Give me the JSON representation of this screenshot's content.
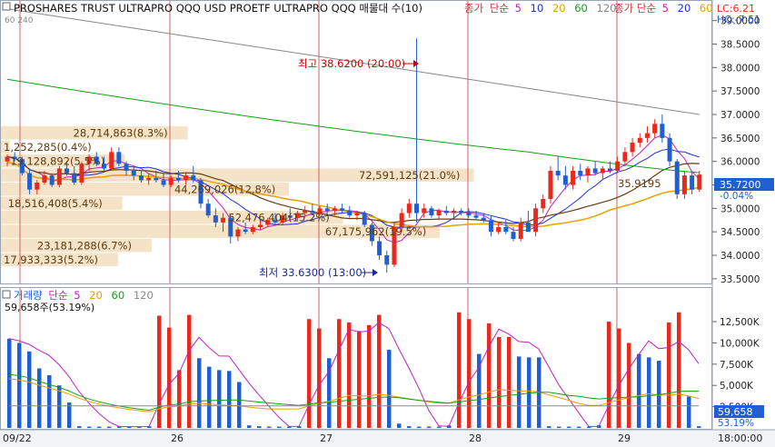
{
  "header": {
    "title": "PROSHARES TRUST ULTRAPRO QQQ USD  PROETF ULTRAPRO QQQ 매물대 수(10)",
    "price_label": "종가",
    "ma_label": "단순",
    "ma_periods": [
      "5",
      "10",
      "20",
      "60",
      "120"
    ],
    "ma_label_b": "종가 단순",
    "ma_periods_b": [
      "5",
      "20",
      "60"
    ],
    "lc": "LC:6.21",
    "hc": "HC:-7.51",
    "corner_label": "60 240"
  },
  "price_panel": {
    "y_ticks": [
      "39.0000",
      "38.5000",
      "38.0000",
      "37.5000",
      "37.0000",
      "36.5000",
      "36.0000",
      "35.5000",
      "35.0000",
      "34.5000",
      "34.0000",
      "33.5000"
    ],
    "current_price": "35.7200",
    "current_change": "-0.04%",
    "high_note": "최고 38.6200 (20:00)",
    "low_note": "최저 33.6300 (13:00)",
    "volume_profile": [
      {
        "label": "28,714,863(8.3%)",
        "price_top": 36.75,
        "price_bottom": 36.45,
        "value": 8.3
      },
      {
        "label": "1,252,285(0.4%)",
        "price_top": 36.45,
        "price_bottom": 36.15,
        "value": 0.4
      },
      {
        "label": "19,128,892(5.5%)",
        "price_top": 36.15,
        "price_bottom": 35.85,
        "value": 5.5
      },
      {
        "label": "72,591,125(21.0%)",
        "price_top": 35.85,
        "price_bottom": 35.55,
        "value": 21.0
      },
      {
        "label": "44,269,026(12.8%)",
        "price_top": 35.55,
        "price_bottom": 35.25,
        "value": 12.8
      },
      {
        "label": "18,516,408(5.4%)",
        "price_top": 35.25,
        "price_bottom": 34.95,
        "value": 5.4
      },
      {
        "label": "52,476,404(15.2%)",
        "price_top": 34.95,
        "price_bottom": 34.65,
        "value": 15.2
      },
      {
        "label": "67,175,962(19.5%)",
        "price_top": 34.65,
        "price_bottom": 34.35,
        "value": 19.5
      },
      {
        "label": "23,181,288(6.7%)",
        "price_top": 34.35,
        "price_bottom": 34.05,
        "value": 6.7
      },
      {
        "label": "17,933,333(5.2%)",
        "price_top": 34.05,
        "price_bottom": 33.75,
        "value": 5.2
      }
    ],
    "overlay_label": "35.9195"
  },
  "volume_panel": {
    "title": "거래량",
    "ma_label": "단순",
    "ma_periods": [
      "5",
      "20",
      "60",
      "120"
    ],
    "current_info": "59,658주(53.19%)",
    "y_ticks": [
      "12,500K",
      "10,000K",
      "7,500K",
      "5,000K",
      "2,500K"
    ],
    "current_value": "59,658",
    "current_pct": "53.19%"
  },
  "x_axis": {
    "labels": [
      "09/22",
      "26",
      "27",
      "28",
      "29",
      "18:00:00"
    ]
  },
  "colors": {
    "up": "#e8291c",
    "down": "#1f5fd1",
    "ma5": "#c21fc0",
    "ma10": "#1d2fd8",
    "ma20": "#6b3a12",
    "ma60": "#16a016",
    "ma120": "#888888",
    "ma_orange": "#e8a000",
    "profile": "#f5e3c8",
    "session": "#d06060"
  },
  "chart_data": {
    "type": "candlestick",
    "price_range": [
      33.4,
      39.4
    ],
    "volume_range": [
      0,
      14000
    ],
    "candles": [
      [
        36.0,
        36.15,
        35.9,
        36.1
      ],
      [
        36.1,
        36.2,
        36.0,
        36.05
      ],
      [
        36.05,
        36.1,
        35.7,
        35.75
      ],
      [
        35.75,
        35.85,
        35.3,
        35.4
      ],
      [
        35.4,
        35.6,
        35.3,
        35.55
      ],
      [
        35.55,
        35.8,
        35.5,
        35.7
      ],
      [
        35.7,
        35.75,
        35.45,
        35.5
      ],
      [
        35.5,
        35.9,
        35.45,
        35.85
      ],
      [
        35.85,
        36.0,
        35.7,
        35.75
      ],
      [
        35.75,
        35.9,
        35.5,
        35.55
      ],
      [
        35.55,
        36.0,
        35.5,
        35.95
      ],
      [
        35.95,
        36.15,
        35.8,
        36.1
      ],
      [
        36.1,
        36.2,
        35.9,
        35.95
      ],
      [
        35.95,
        36.1,
        35.8,
        35.85
      ],
      [
        35.85,
        36.3,
        35.8,
        36.2
      ],
      [
        36.2,
        36.3,
        35.9,
        35.95
      ],
      [
        35.95,
        36.0,
        35.7,
        35.8
      ],
      [
        35.8,
        35.9,
        35.6,
        35.7
      ],
      [
        35.7,
        35.8,
        35.55,
        35.6
      ],
      [
        35.6,
        35.75,
        35.5,
        35.65
      ],
      [
        35.65,
        35.8,
        35.55,
        35.6
      ],
      [
        35.6,
        35.75,
        35.45,
        35.5
      ],
      [
        35.5,
        35.7,
        35.45,
        35.65
      ],
      [
        35.65,
        35.8,
        35.55,
        35.6
      ],
      [
        35.6,
        35.75,
        35.5,
        35.7
      ],
      [
        35.7,
        35.9,
        35.55,
        35.6
      ],
      [
        35.6,
        35.65,
        35.0,
        35.1
      ],
      [
        35.1,
        35.2,
        34.8,
        34.85
      ],
      [
        34.85,
        35.0,
        34.6,
        34.7
      ],
      [
        34.7,
        34.9,
        34.5,
        34.8
      ],
      [
        34.8,
        34.85,
        34.25,
        34.4
      ],
      [
        34.4,
        34.6,
        34.3,
        34.55
      ],
      [
        34.55,
        34.7,
        34.45,
        34.5
      ],
      [
        34.5,
        34.65,
        34.45,
        34.6
      ],
      [
        34.6,
        34.75,
        34.55,
        34.65
      ],
      [
        34.65,
        34.8,
        34.6,
        34.75
      ],
      [
        34.75,
        34.9,
        34.65,
        34.7
      ],
      [
        34.7,
        34.9,
        34.65,
        34.85
      ],
      [
        34.85,
        35.0,
        34.75,
        34.8
      ],
      [
        34.8,
        34.95,
        34.75,
        34.9
      ],
      [
        34.9,
        35.05,
        34.8,
        34.95
      ],
      [
        34.95,
        35.1,
        34.85,
        34.9
      ],
      [
        34.9,
        35.05,
        34.85,
        35.0
      ],
      [
        35.0,
        35.1,
        34.9,
        34.95
      ],
      [
        34.95,
        35.05,
        34.85,
        35.0
      ],
      [
        35.0,
        35.1,
        34.9,
        34.95
      ],
      [
        34.95,
        35.05,
        34.8,
        34.85
      ],
      [
        34.85,
        34.95,
        34.75,
        34.9
      ],
      [
        34.9,
        34.95,
        34.6,
        34.65
      ],
      [
        34.65,
        34.7,
        34.2,
        34.3
      ],
      [
        34.3,
        34.4,
        33.9,
        34.0
      ],
      [
        34.0,
        34.1,
        33.63,
        33.8
      ],
      [
        33.8,
        34.7,
        33.75,
        34.6
      ],
      [
        34.6,
        35.0,
        34.5,
        34.9
      ],
      [
        34.9,
        35.2,
        34.8,
        35.1
      ],
      [
        35.1,
        38.62,
        34.7,
        34.9
      ],
      [
        34.9,
        35.1,
        34.8,
        35.0
      ],
      [
        35.0,
        35.05,
        34.8,
        34.85
      ],
      [
        34.85,
        35.0,
        34.75,
        34.95
      ],
      [
        34.95,
        35.05,
        34.85,
        34.9
      ],
      [
        34.9,
        35.0,
        34.8,
        34.95
      ],
      [
        34.95,
        35.0,
        34.85,
        34.9
      ],
      [
        34.9,
        35.0,
        34.8,
        34.85
      ],
      [
        34.85,
        34.95,
        34.75,
        34.8
      ],
      [
        34.8,
        34.9,
        34.7,
        34.75
      ],
      [
        34.75,
        34.85,
        34.4,
        34.5
      ],
      [
        34.5,
        34.7,
        34.45,
        34.6
      ],
      [
        34.6,
        34.75,
        34.45,
        34.5
      ],
      [
        34.5,
        34.6,
        34.3,
        34.35
      ],
      [
        34.35,
        34.8,
        34.3,
        34.7
      ],
      [
        34.7,
        34.95,
        34.6,
        34.5
      ],
      [
        34.5,
        35.1,
        34.4,
        35.0
      ],
      [
        35.0,
        35.3,
        34.9,
        35.2
      ],
      [
        35.2,
        35.9,
        35.1,
        35.8
      ],
      [
        35.8,
        36.1,
        35.6,
        35.7
      ],
      [
        35.7,
        35.9,
        35.4,
        35.5
      ],
      [
        35.5,
        35.9,
        35.4,
        35.8
      ],
      [
        35.8,
        35.95,
        35.6,
        35.7
      ],
      [
        35.7,
        35.9,
        35.55,
        35.85
      ],
      [
        35.85,
        36.0,
        35.7,
        35.75
      ],
      [
        35.75,
        35.9,
        35.6,
        35.85
      ],
      [
        35.85,
        36.0,
        35.75,
        35.8
      ],
      [
        35.8,
        36.1,
        35.75,
        36.0
      ],
      [
        36.0,
        36.3,
        35.9,
        36.2
      ],
      [
        36.2,
        36.5,
        36.1,
        36.4
      ],
      [
        36.4,
        36.6,
        36.3,
        36.5
      ],
      [
        36.5,
        36.75,
        36.4,
        36.6
      ],
      [
        36.6,
        36.9,
        36.5,
        36.8
      ],
      [
        36.8,
        37.0,
        36.4,
        36.5
      ],
      [
        36.5,
        36.6,
        35.9,
        36.0
      ],
      [
        36.0,
        36.05,
        35.2,
        35.3
      ],
      [
        35.3,
        35.8,
        35.2,
        35.7
      ],
      [
        35.7,
        35.8,
        35.3,
        35.4
      ],
      [
        35.4,
        35.8,
        35.35,
        35.72
      ]
    ],
    "volumes": [
      {
        "v": 10500,
        "up": false
      },
      {
        "v": 10000,
        "up": false
      },
      {
        "v": 9000,
        "up": false
      },
      {
        "v": 7000,
        "up": false
      },
      {
        "v": 6200,
        "up": false
      },
      {
        "v": 5000,
        "up": false
      },
      {
        "v": 3000,
        "up": false
      },
      {
        "v": 200,
        "up": false
      },
      {
        "v": 150,
        "up": false
      },
      {
        "v": 150,
        "up": false
      },
      {
        "v": 150,
        "up": false
      },
      {
        "v": 150,
        "up": false
      },
      {
        "v": 150,
        "up": false
      },
      {
        "v": 150,
        "up": false
      },
      {
        "v": 200,
        "up": false
      },
      {
        "v": 13200,
        "up": true
      },
      {
        "v": 11800,
        "up": true
      },
      {
        "v": 6800,
        "up": true
      },
      {
        "v": 13300,
        "up": true
      },
      {
        "v": 8200,
        "up": false
      },
      {
        "v": 7200,
        "up": false
      },
      {
        "v": 6800,
        "up": false
      },
      {
        "v": 6700,
        "up": false
      },
      {
        "v": 5400,
        "up": false
      },
      {
        "v": 300,
        "up": false
      },
      {
        "v": 200,
        "up": false
      },
      {
        "v": 150,
        "up": false
      },
      {
        "v": 150,
        "up": false
      },
      {
        "v": 150,
        "up": false
      },
      {
        "v": 200,
        "up": false
      },
      {
        "v": 12800,
        "up": true
      },
      {
        "v": 11700,
        "up": true
      },
      {
        "v": 8200,
        "up": false
      },
      {
        "v": 12800,
        "up": true
      },
      {
        "v": 12400,
        "up": true
      },
      {
        "v": 11400,
        "up": true
      },
      {
        "v": 12100,
        "up": true
      },
      {
        "v": 13300,
        "up": true
      },
      {
        "v": 9200,
        "up": false
      },
      {
        "v": 500,
        "up": false
      },
      {
        "v": 200,
        "up": false
      },
      {
        "v": 150,
        "up": false
      },
      {
        "v": 150,
        "up": false
      },
      {
        "v": 150,
        "up": false
      },
      {
        "v": 300,
        "up": false
      },
      {
        "v": 13600,
        "up": true
      },
      {
        "v": 12800,
        "up": true
      },
      {
        "v": 8700,
        "up": false
      },
      {
        "v": 12300,
        "up": true
      },
      {
        "v": 10700,
        "up": true
      },
      {
        "v": 10700,
        "up": true
      },
      {
        "v": 8400,
        "up": false
      },
      {
        "v": 8300,
        "up": false
      },
      {
        "v": 8300,
        "up": false
      },
      {
        "v": 200,
        "up": false
      },
      {
        "v": 150,
        "up": false
      },
      {
        "v": 150,
        "up": false
      },
      {
        "v": 150,
        "up": false
      },
      {
        "v": 150,
        "up": false
      },
      {
        "v": 300,
        "up": false
      },
      {
        "v": 12500,
        "up": true
      },
      {
        "v": 11700,
        "up": true
      },
      {
        "v": 10000,
        "up": true
      },
      {
        "v": 8700,
        "up": false
      },
      {
        "v": 8300,
        "up": false
      },
      {
        "v": 7900,
        "up": false
      },
      {
        "v": 12400,
        "up": true
      },
      {
        "v": 13600,
        "up": true
      },
      {
        "v": 3700,
        "up": false
      },
      {
        "v": 200,
        "up": false
      }
    ]
  }
}
